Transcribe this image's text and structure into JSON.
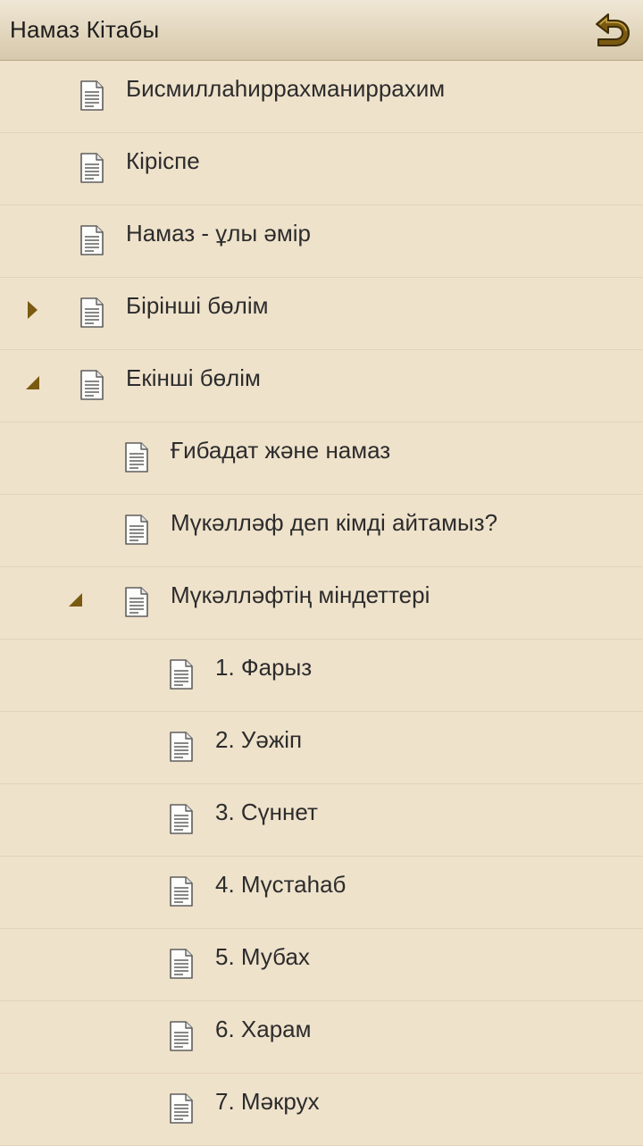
{
  "app": {
    "title": "Намаз Кітабы",
    "back_icon": "undo-arrow-icon",
    "accent_color": "#7a5a10",
    "background_color": "#efe2cb"
  },
  "tree": {
    "items": [
      {
        "label": "Бисмиллаһиррахманиррахим",
        "level": 0,
        "expander": "none"
      },
      {
        "label": "Кіріспе",
        "level": 0,
        "expander": "none"
      },
      {
        "label": "Намаз - ұлы әмір",
        "level": 0,
        "expander": "none"
      },
      {
        "label": "Бірінші бөлім",
        "level": 0,
        "expander": "collapsed"
      },
      {
        "label": "Екінші бөлім",
        "level": 0,
        "expander": "expanded"
      },
      {
        "label": "Ғибадат және намаз",
        "level": 1,
        "expander": "none"
      },
      {
        "label": "Мүкәлләф деп кімді айтамыз?",
        "level": 1,
        "expander": "none"
      },
      {
        "label": "Мүкәлләфтің міндеттері",
        "level": 1,
        "expander": "expanded"
      },
      {
        "label": "1. Фарыз",
        "level": 2,
        "expander": "none"
      },
      {
        "label": "2. Уәжіп",
        "level": 2,
        "expander": "none"
      },
      {
        "label": "3. Сүннет",
        "level": 2,
        "expander": "none"
      },
      {
        "label": "4. Мүстаһаб",
        "level": 2,
        "expander": "none"
      },
      {
        "label": "5. Мубах",
        "level": 2,
        "expander": "none"
      },
      {
        "label": "6. Харам",
        "level": 2,
        "expander": "none"
      },
      {
        "label": "7. Мәкрух",
        "level": 2,
        "expander": "none"
      }
    ]
  }
}
